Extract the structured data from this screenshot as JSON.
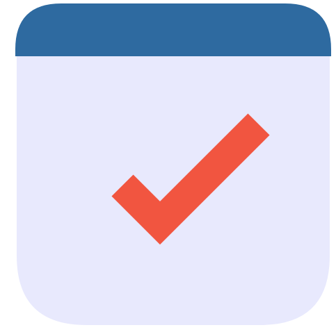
{
  "icon": {
    "name": "calendar-check-icon",
    "colors": {
      "header": "#2e6aa0",
      "body": "#e8e9fd",
      "checkmark": "#f15540"
    }
  }
}
